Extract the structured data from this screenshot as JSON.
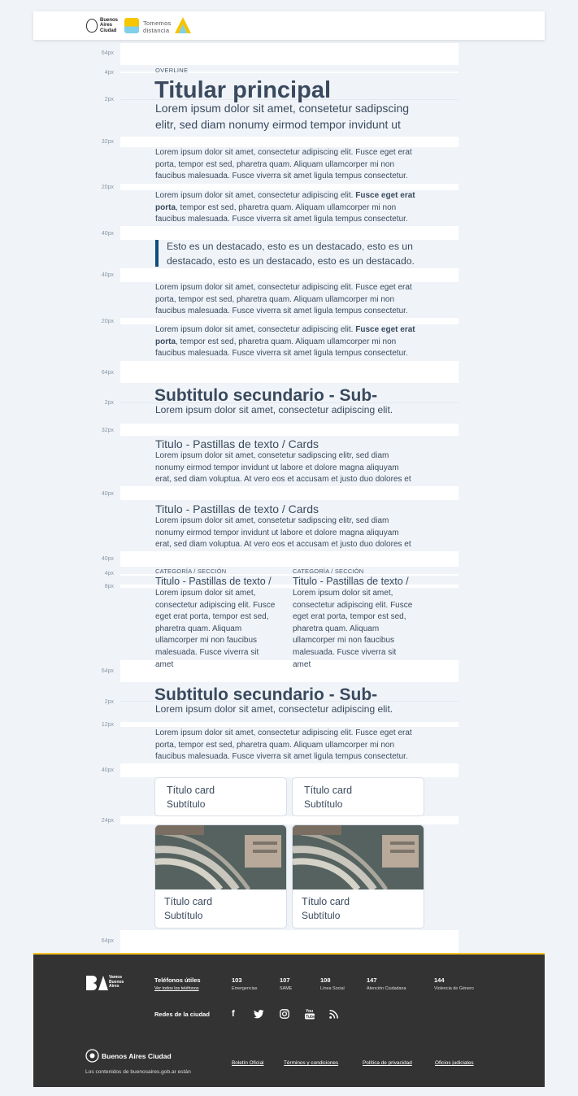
{
  "header": {
    "logo_lines": [
      "Buenos",
      "Aires",
      "Ciudad"
    ],
    "tomemos_lines": [
      "Tomemos",
      "distancia"
    ]
  },
  "spacing": {
    "s64a": "64px",
    "s4": "4px",
    "s2a": "2px",
    "s32a": "32px",
    "s20a": "20px",
    "s40a": "40px",
    "s40b": "40px",
    "s20b": "20px",
    "s64b": "64px",
    "s2b": "2px",
    "s32b": "32px",
    "s40c": "40px",
    "s40d": "40px",
    "s4b": "4px",
    "s8": "8px",
    "s64c": "64px",
    "s2c": "2px",
    "s12": "12px",
    "s40e": "40px",
    "s24": "24px",
    "s64d": "64px"
  },
  "content": {
    "overline": "OVERLINE",
    "title": "Titular principal",
    "lead_1": "Lorem ipsum dolor sit amet, consetetur sadipscing",
    "lead_2": "elitr, sed diam nonumy eirmod tempor invidunt ut",
    "para_1": [
      "Lorem ipsum dolor sit amet, consectetur adipiscing elit. Fusce eget erat",
      "porta, tempor est sed, pharetra quam. Aliquam ullamcorper mi non",
      "faucibus malesuada. Fusce viverra sit amet ligula tempus consectetur."
    ],
    "para_2_pre": "Lorem ipsum dolor sit amet, consectetur adipiscing elit. ",
    "para_2_bold": "Fusce eget erat",
    "para_2_bold2": "porta",
    "para_2_rest": ", tempor est sed, pharetra quam. Aliquam ullamcorper mi non",
    "para_2_last": "faucibus malesuada. Fusce viverra sit amet ligula tempus consectetur.",
    "quote_1": "Esto es un destacado, esto es un destacado, esto es un",
    "quote_2": "destacado, esto es un destacado, esto es un destacado.",
    "subtitle": "Subtitulo secundario - Sub-",
    "subtitle_text": "Lorem ipsum dolor sit amet, consectetur adipiscing elit.",
    "cards_title": "Titulo - Pastillas de texto / Cards",
    "cards_text": [
      "Lorem ipsum dolor sit amet, consetetur sadipscing elitr, sed diam",
      "nonumy eirmod tempor invidunt ut labore et dolore magna aliquyam",
      "erat, sed diam voluptua. At vero eos et accusam et justo duo dolores et"
    ],
    "category": "CATEGORÍA / SECCIÓN",
    "col_title": "Titulo - Pastillas de texto /",
    "col_text": [
      "Lorem ipsum dolor sit amet,",
      "consectetur adipiscing elit. Fusce",
      "eget erat porta, tempor est sed,",
      "pharetra quam. Aliquam",
      "ullamcorper mi non faucibus",
      "malesuada. Fusce viverra sit amet"
    ],
    "card_title": "Título card",
    "card_subtitle": "Subtítulo"
  },
  "footer": {
    "ba_logo_lines": [
      "Vamos",
      "Buenos",
      "Aires"
    ],
    "phones_title": "Teléfonos útiles",
    "phones_link": "Ver todos los teléfonos",
    "phones": [
      {
        "number": "103",
        "label": "Emergencias"
      },
      {
        "number": "107",
        "label": "SAME"
      },
      {
        "number": "108",
        "label": "Línea Social"
      },
      {
        "number": "147",
        "label": "Atención Ciudadana"
      },
      {
        "number": "144",
        "label": "Violencia de Género"
      }
    ],
    "social_title": "Redes de la ciudad",
    "social_icons": [
      "facebook-icon",
      "twitter-icon",
      "instagram-icon",
      "youtube-icon",
      "rss-icon"
    ],
    "brand": "Buenos Aires Ciudad",
    "legal": "Los contenidos de buenosaires.gob.ar están",
    "links": [
      "Boletín Oficial",
      "Términos y condiciones",
      "Política de privacidad",
      "Oficios judiciales"
    ]
  }
}
